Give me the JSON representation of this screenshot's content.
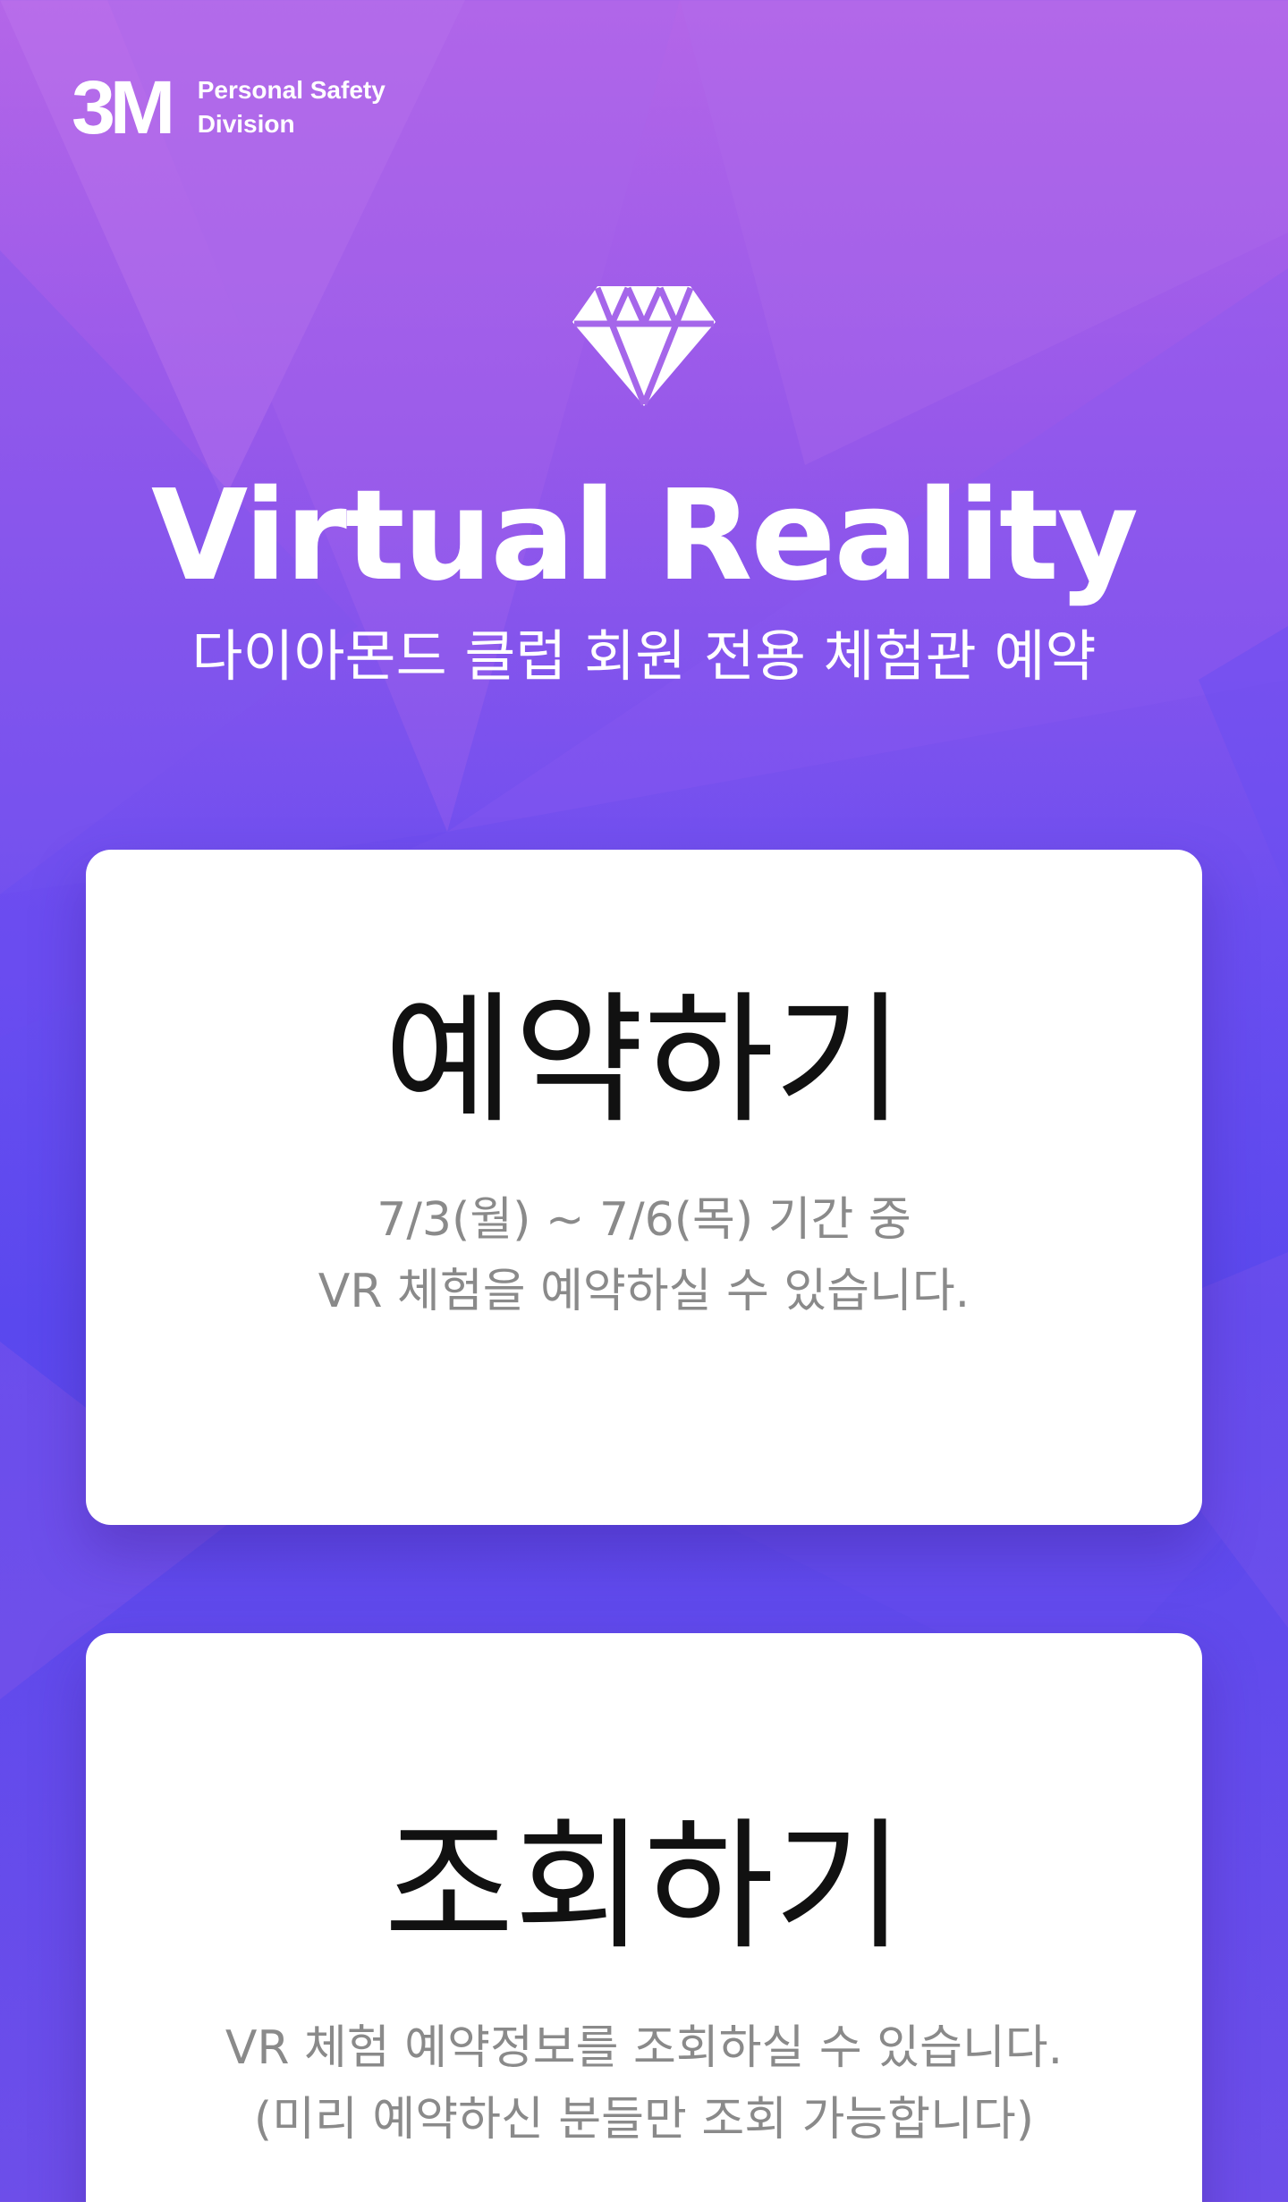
{
  "brand": {
    "logo_mark": "3M",
    "division_line1": "Personal Safety",
    "division_line2": "Division"
  },
  "hero": {
    "icon": "diamond-icon",
    "title": "Virtual Reality",
    "subtitle": "다이아몬드 클럽 회원 전용 체험관 예약"
  },
  "cards": {
    "reserve": {
      "title": "예약하기",
      "desc_line1": "7/3(월) ~ 7/6(목) 기간 중",
      "desc_line2": "VR 체험을 예약하실 수 있습니다."
    },
    "lookup": {
      "title": "조회하기",
      "desc_line1": "VR 체험 예약정보를 조회하실 수 있습니다.",
      "desc_line2": "(미리 예약하신 분들만 조회 가능합니다)"
    }
  },
  "colors": {
    "background_top": "#b466e8",
    "background_bottom": "#5a48ee",
    "card_background": "#ffffff",
    "card_title": "#111111",
    "card_description": "#8a8a8a"
  }
}
